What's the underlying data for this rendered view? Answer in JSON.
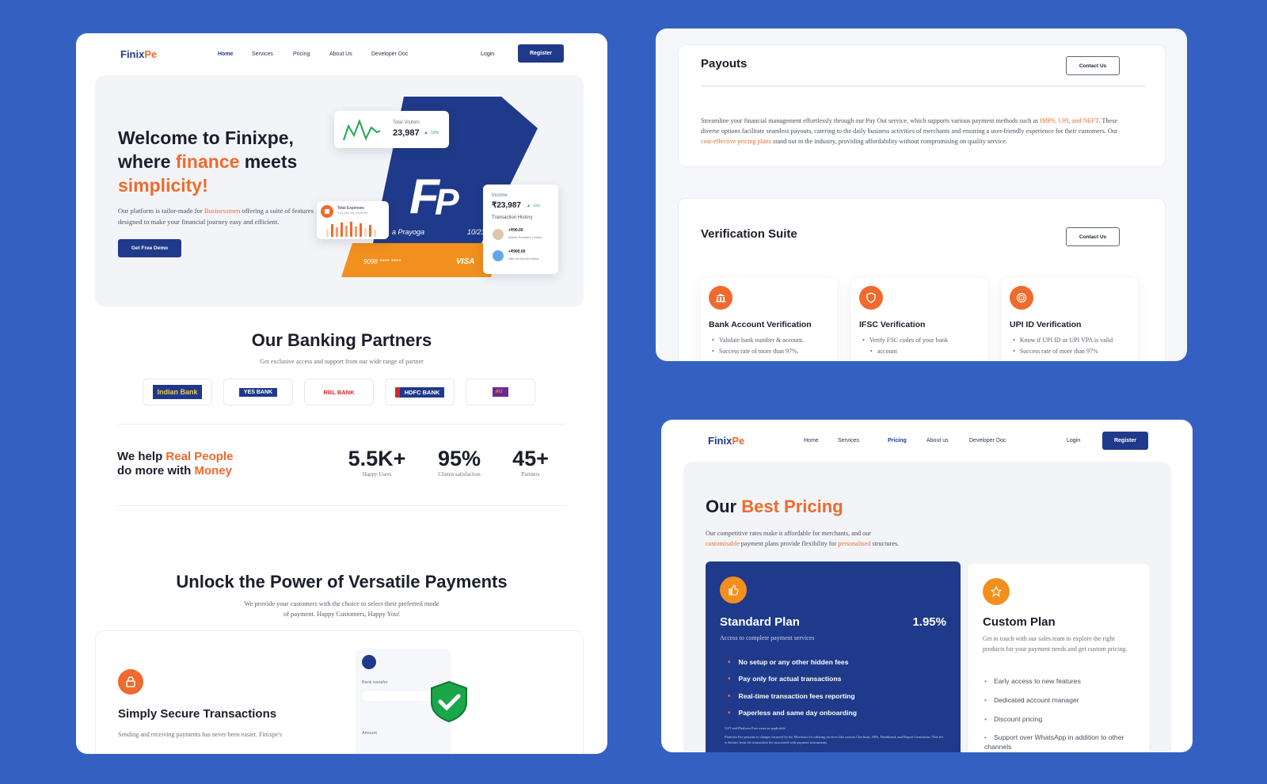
{
  "nav": {
    "logo_a": "Finix",
    "logo_b": "Pe",
    "links": [
      "Home",
      "Services",
      "Pricing",
      "About Us",
      "Developer Doc"
    ],
    "links_pricing_page": [
      "Home",
      "Services",
      "Pricing",
      "About us",
      "Developer Doc"
    ],
    "login": "Login",
    "register": "Register"
  },
  "hero": {
    "title_1": "Welcome to Finixpe,",
    "title_2a": "where ",
    "title_2b": "finance",
    "title_2c": " meets",
    "title_3": "simplicity!",
    "desc_a": "Our platform is tailor-made for ",
    "desc_b": "Businessmen",
    "desc_c": " offering a suite of features designed to make your financial journey easy and efficient.",
    "cta": "Get Free Demo",
    "visitors_label": "Total Visitors",
    "visitors_value": "23,987",
    "visitors_delta": "10%",
    "expenses_label": "Total Expenses",
    "expenses_sub": "Your total daily expenses",
    "card_name": "a Prayoga",
    "card_exp": "10/23",
    "card_number": "9098 **** ****",
    "card_brand": "VISA",
    "income_label": "Income",
    "income_value": "₹23,987",
    "income_delta": "10%",
    "history_label": "Transaction History",
    "tx": [
      {
        "amount": "+₹90.00",
        "name": "Adidas Sneakers Limited"
      },
      {
        "amount": "+₹900.00",
        "name": "Nike Air Special Edition"
      }
    ]
  },
  "partners": {
    "title": "Our Banking Partners",
    "subtitle": "Get exclusive access and support from our wide range of partner",
    "logos": [
      "Indian Bank",
      "YES BANK",
      "RBL BANK",
      "HDFC BANK",
      "AU"
    ]
  },
  "stats": {
    "line1a": "We help ",
    "line1b": "Real People",
    "line2a": "do more with ",
    "line2b": "Money",
    "items": [
      {
        "value": "5.5K+",
        "label": "Happy Users"
      },
      {
        "value": "95%",
        "label": "Clients satisfaction"
      },
      {
        "value": "45+",
        "label": "Partners"
      }
    ]
  },
  "payments": {
    "title": "Unlock the Power of Versatile Payments",
    "sub1": "We provide your customers with the choice to select their preferred mode",
    "sub2": "of payment. Happy Customers, Happy You!",
    "secure_title": "Simply Secure Transactions",
    "secure_desc": "Sending and receiving payments has never been easier. Finixpe's",
    "bank_transfer": "Bank transfer",
    "amount": "Amount"
  },
  "payouts": {
    "title": "Payouts",
    "contact": "Contact Us",
    "p_a": "Streamline your financial management effortlessly through our Pay Out service, which supports various payment methods such as ",
    "p_b": "IMPS, UPI, and NEFT",
    "p_c": ". These diverse options facilitate seamless payouts, catering to the daily business activities of merchants and ensuring a user-friendly experience for their customers. Our ",
    "p_d": "cost-effective pricing plans",
    "p_e": " stand out in the industry, providing affordability without compromising on quality service."
  },
  "verification": {
    "title": "Verification Suite",
    "contact": "Contact Us",
    "cards": [
      {
        "title": "Bank Account Verification",
        "b1": "Validate bank number & account.",
        "b2": "Success rate of more than 97%."
      },
      {
        "title": "IFSC Verification",
        "b1": "Verify FSC codes of your bank",
        "b2": "account"
      },
      {
        "title": "UPI ID Verification",
        "b1": "Know if UPI ID or UPI VPA is valid",
        "b2": "Success rate of more than 97%"
      }
    ]
  },
  "pricing": {
    "title_a": "Our ",
    "title_b": "Best Pricing",
    "desc_1": "Our competitive rates make it affordable for merchants, and our",
    "desc_2a": "customisable",
    "desc_2b": " payment plans provide flexibility for ",
    "desc_2c": "personalised",
    "desc_2d": " structures.",
    "standard": {
      "name": "Standard Plan",
      "rate": "1.95%",
      "sub": "Access to complete payment services",
      "features": [
        "No setup or any other hidden fees",
        "Pay only for actual transactions",
        "Real-time transaction fees reporting",
        "Paperless and same day onboarding"
      ],
      "note1": "GST and Platform Fees extra as applicable",
      "note2": "Platform Fee pertains to charges incurred by the Merchant for utilizing services like custom Checkout, APIs, Dashboard, and Report Generation. This fee is distinct from the transaction fee associated with payment instruments."
    },
    "custom": {
      "name": "Custom Plan",
      "desc": "Get in touch with our sales team to explore the right products for your payment needs and get custom pricing.",
      "features": [
        "Early access to new features",
        "Dedicated account manager",
        "Discount pricing",
        "Support over WhatsApp in addition to other channels"
      ]
    }
  }
}
